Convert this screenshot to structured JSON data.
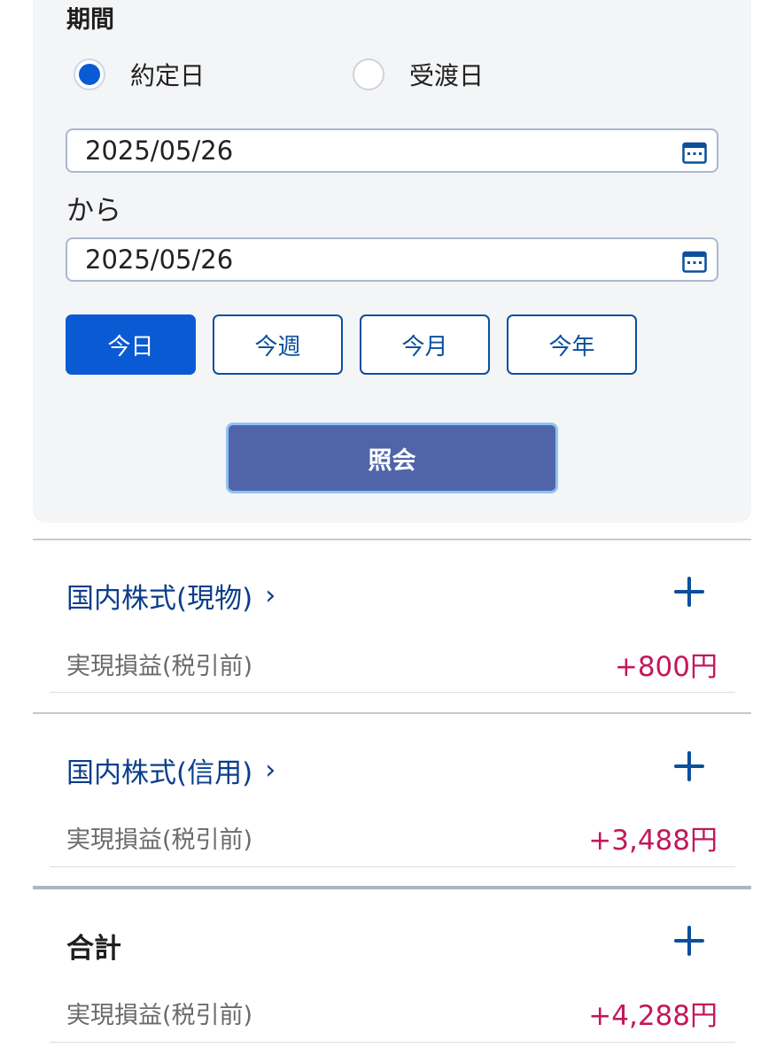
{
  "filter": {
    "period_label": "期間",
    "radio_options": [
      {
        "label": "約定日",
        "checked": true
      },
      {
        "label": "受渡日",
        "checked": false
      }
    ],
    "date_from": "2025/05/26",
    "separator": "から",
    "date_to": "2025/05/26",
    "quick_buttons": [
      {
        "label": "今日",
        "active": true
      },
      {
        "label": "今週",
        "active": false
      },
      {
        "label": "今月",
        "active": false
      },
      {
        "label": "今年",
        "active": false
      }
    ],
    "query_button": "照会"
  },
  "sections": [
    {
      "title": "国内株式(現物)",
      "chevron": "›",
      "pl_label": "実現損益(税引前)",
      "pl_value": "+800円"
    },
    {
      "title": "国内株式(信用)",
      "chevron": "›",
      "pl_label": "実現損益(税引前)",
      "pl_value": "+3,488円"
    }
  ],
  "total": {
    "title": "合計",
    "pl_label": "実現損益(税引前)",
    "pl_value": "+4,288円"
  },
  "colors": {
    "accent": "#0a5bd3",
    "link": "#0b3e8a",
    "profit": "#c2185b",
    "query_button": "#5065a9"
  },
  "icons": {
    "calendar": "calendar-icon",
    "expand": "plus-icon",
    "chevron": "chevron-right-icon"
  }
}
